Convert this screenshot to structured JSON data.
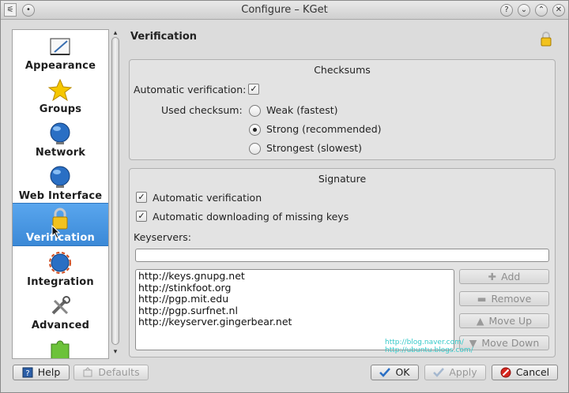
{
  "window": {
    "title": "Configure – KGet"
  },
  "sidebar": {
    "items": [
      {
        "label": "Appearance"
      },
      {
        "label": "Groups"
      },
      {
        "label": "Network"
      },
      {
        "label": "Web Interface"
      },
      {
        "label": "Verification",
        "selected": true
      },
      {
        "label": "Integration"
      },
      {
        "label": "Advanced"
      },
      {
        "label": ""
      }
    ]
  },
  "page": {
    "title": "Verification"
  },
  "checksums": {
    "title": "Checksums",
    "auto_label": "Automatic verification:",
    "auto_checked": true,
    "used_label": "Used checksum:",
    "options": [
      {
        "label": "Weak (fastest)",
        "checked": false
      },
      {
        "label": "Strong (recommended)",
        "checked": true
      },
      {
        "label": "Strongest (slowest)",
        "checked": false
      }
    ]
  },
  "signature": {
    "title": "Signature",
    "auto_verification": "Automatic verification",
    "auto_download": "Automatic downloading of missing keys",
    "keyservers_label": "Keyservers:",
    "keyserver_input": "",
    "servers": [
      "http://keys.gnupg.net",
      "http://stinkfoot.org",
      "http://pgp.mit.edu",
      "http://pgp.surfnet.nl",
      "http://keyserver.gingerbear.net"
    ],
    "buttons": {
      "add": "Add",
      "remove": "Remove",
      "move_up": "Move Up",
      "move_down": "Move Down"
    }
  },
  "footer": {
    "help": "Help",
    "defaults": "Defaults",
    "ok": "OK",
    "apply": "Apply",
    "cancel": "Cancel"
  },
  "watermark": {
    "line1": "http://blog.naver.com/",
    "line2": "http://ubuntu.blogs.com/"
  },
  "colors": {
    "selection": "#3b89d7",
    "window_bg": "#dcdcdc"
  }
}
